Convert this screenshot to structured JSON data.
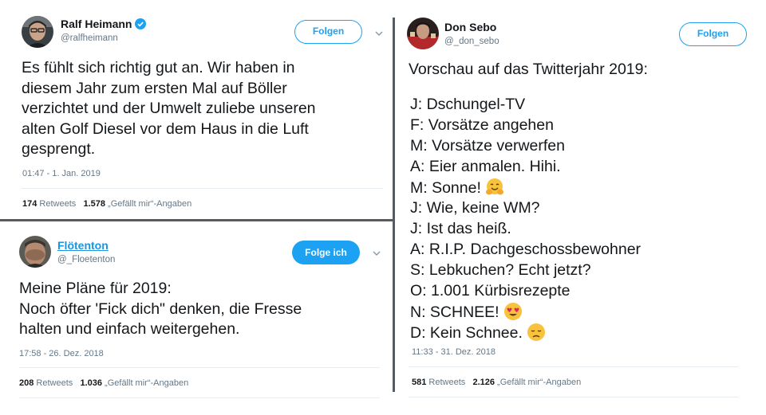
{
  "tweets": [
    {
      "name": "Ralf Heimann",
      "handle": "@ralfheimann",
      "follow_label": "Folgen",
      "text": "Es fühlt sich richtig gut an. Wir haben in\ndiesem Jahr zum ersten Mal auf Böller\nverzichtet und der Umwelt zuliebe unseren\nalten Golf Diesel vor dem Haus in die Luft\ngesprengt.",
      "timestamp": "01:47 - 1. Jan. 2019",
      "retweets": "174",
      "retweets_label": "Retweets",
      "likes": "1.578",
      "likes_label": "„Gefällt mir“-Angaben"
    },
    {
      "name": "Flötenton",
      "handle": "@_Floetenton",
      "follow_label": "Folge ich",
      "text": "Meine Pläne für 2019:\nNoch öfter 'Fick dich\" denken, die Fresse\nhalten und einfach weitergehen.",
      "timestamp": "17:58 - 26. Dez. 2018",
      "retweets": "208",
      "retweets_label": "Retweets",
      "likes": "1.036",
      "likes_label": "„Gefällt mir“-Angaben"
    },
    {
      "name": "Don Sebo",
      "handle": "@_don_sebo",
      "follow_label": "Folgen",
      "intro": "Vorschau auf das Twitterjahr 2019:",
      "lines": [
        "J: Dschungel-TV",
        "F: Vorsätze angehen",
        "M: Vorsätze verwerfen",
        "A: Eier anmalen. Hihi.",
        "M: Sonne!",
        "J: Wie, keine WM?",
        "J: Ist das heiß.",
        "A: R.I.P. Dachgeschossbewohner",
        "S: Lebkuchen? Echt jetzt?",
        "O: 1.001 Kürbisrezepte",
        "N: SCHNEE!",
        "D: Kein Schnee."
      ],
      "emojis": {
        "4": "hugging-face-emoji",
        "10": "heart-eyes-emoji",
        "11": "disappointed-face-emoji"
      },
      "timestamp": "11:33 - 31. Dez. 2018",
      "retweets": "581",
      "retweets_label": "Retweets",
      "likes": "2.126",
      "likes_label": "„Gefällt mir“-Angaben"
    }
  ],
  "colors": {
    "accent": "#1da1f2",
    "name_link": "#1b95e0",
    "muted": "#657786",
    "text": "#14171a",
    "divider": "#555b61"
  }
}
